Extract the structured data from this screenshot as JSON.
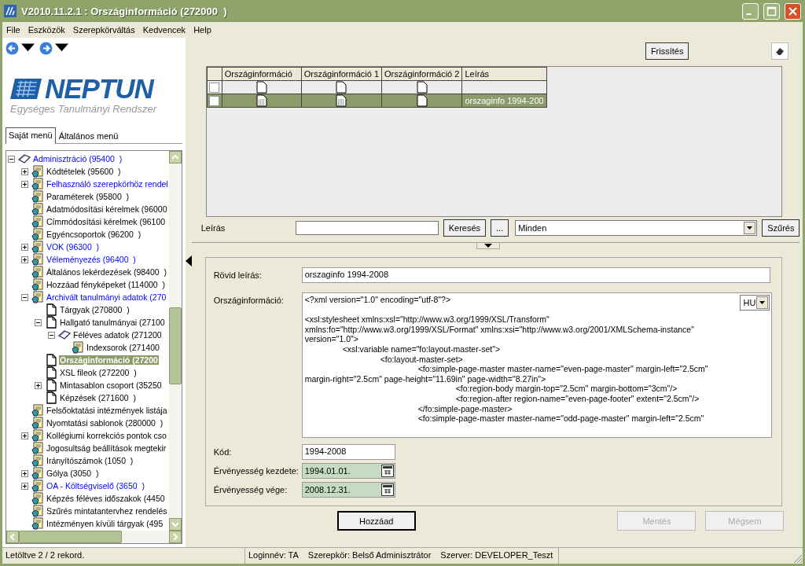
{
  "window": {
    "title": "V2010.11.2.1 : Országinformáció (272000  )"
  },
  "menu": [
    "File",
    "Eszközök",
    "Szerepkörváltás",
    "Kedvencek",
    "Help"
  ],
  "logo": {
    "name": "NEPTUN",
    "tagline": "Egységes Tanulmányi Rendszer"
  },
  "menu_tabs": [
    {
      "label": "Saját menü",
      "selected": true
    },
    {
      "label": "Általános menü",
      "selected": false
    }
  ],
  "tree": [
    {
      "label": "Adminisztráció (95400  )",
      "kind": "book",
      "highlighted": true,
      "expanded": true,
      "selected": false,
      "children": [
        {
          "label": "Kódtételek (95600  )",
          "kind": "form",
          "highlighted": false,
          "expanded": false,
          "selected": false
        },
        {
          "label": "Felhasználó szerepkörhöz rendel",
          "kind": "form",
          "highlighted": true,
          "expanded": false,
          "selected": false
        },
        {
          "label": "Paraméterek (95800  )",
          "kind": "form",
          "highlighted": false,
          "selected": false
        },
        {
          "label": "Adatmódosítási kérelmek (96000",
          "kind": "form",
          "highlighted": false,
          "selected": false
        },
        {
          "label": "Címmódosítási kérelmek (96100",
          "kind": "form",
          "highlighted": false,
          "selected": false
        },
        {
          "label": "Egyéncsoportok (96200  )",
          "kind": "form",
          "highlighted": false,
          "selected": false
        },
        {
          "label": "VOK (96300  )",
          "kind": "form",
          "highlighted": true,
          "expanded": false,
          "selected": false
        },
        {
          "label": "Véleményezés (96400  )",
          "kind": "form",
          "highlighted": true,
          "expanded": false,
          "selected": false
        },
        {
          "label": "Általános lekérdezések (98400  )",
          "kind": "form",
          "highlighted": false,
          "selected": false
        },
        {
          "label": "Hozzáad fényképeket (114000  )",
          "kind": "form",
          "highlighted": false,
          "selected": false
        },
        {
          "label": "Archivált tanulmányi adatok (270",
          "kind": "form",
          "highlighted": true,
          "expanded": true,
          "selected": false,
          "children": [
            {
              "label": "Tárgyak (270800  )",
              "kind": "page",
              "highlighted": false,
              "selected": false
            },
            {
              "label": "Hallgató tanulmányai (27100",
              "kind": "page",
              "highlighted": false,
              "expanded": true,
              "selected": false,
              "children": [
                {
                  "label": "Féléves adatok (271200",
                  "kind": "book",
                  "highlighted": false,
                  "expanded": true,
                  "selected": false,
                  "children": [
                    {
                      "label": "Indexsorok (271400",
                      "kind": "form",
                      "highlighted": false,
                      "selected": false
                    }
                  ]
                }
              ]
            },
            {
              "label": "Országinformáció (27200",
              "kind": "page",
              "selected": true
            },
            {
              "label": "XSL fileok (272200  )",
              "kind": "page",
              "highlighted": false,
              "selected": false
            },
            {
              "label": "Mintasablon csoport (35250",
              "kind": "page",
              "highlighted": false,
              "expanded": false,
              "selected": false
            },
            {
              "label": "Képzések (271600  )",
              "kind": "page",
              "highlighted": false,
              "selected": false
            }
          ]
        },
        {
          "label": "Felsőoktatási intézmények listája",
          "kind": "form",
          "highlighted": false,
          "selected": false
        },
        {
          "label": "Nyomtatási sablonok (280000  )",
          "kind": "form",
          "highlighted": false,
          "selected": false
        },
        {
          "label": "Kollégiumi korrekciós pontok cso",
          "kind": "form",
          "highlighted": false,
          "expanded": false,
          "selected": false
        },
        {
          "label": "Jogosultság beállítások megtekir",
          "kind": "form",
          "highlighted": false,
          "selected": false
        },
        {
          "label": "Irányítószámok (1050  )",
          "kind": "form",
          "highlighted": false,
          "selected": false
        },
        {
          "label": "Gólya (3050  )",
          "kind": "form",
          "highlighted": false,
          "expanded": false,
          "selected": false
        },
        {
          "label": "OA - Költségviselő (3650  )",
          "kind": "form",
          "highlighted": true,
          "expanded": false,
          "selected": false
        },
        {
          "label": "Képzés féléves időszakok (4450",
          "kind": "form",
          "highlighted": false,
          "selected": false
        },
        {
          "label": "Szűrés mintatantervhez rendelés",
          "kind": "form",
          "highlighted": false,
          "selected": false
        },
        {
          "label": "Intézményen kívüli tárgyak (495",
          "kind": "form",
          "highlighted": false,
          "selected": false
        }
      ]
    }
  ],
  "toolbar": {
    "refresh": "Frissítés"
  },
  "grid": {
    "columns": [
      "Országinformáció",
      "Országinformáció 1",
      "Országinformáció 2",
      "Leírás"
    ],
    "rows": [
      {
        "checked": false,
        "selected": false,
        "files": [
          {
            "kind": "blank"
          },
          {
            "kind": "blank"
          },
          {
            "kind": "blank"
          }
        ]
      },
      {
        "checked": false,
        "selected": true,
        "files": [
          {
            "kind": "filled"
          },
          {
            "kind": "filled"
          },
          {
            "kind": "blank"
          }
        ],
        "description": "orszaginfo 1994-200"
      }
    ]
  },
  "filter": {
    "label": "Leírás",
    "search": "Keresés",
    "more": "...",
    "scope": "Minden",
    "apply": "Szűrés"
  },
  "detail": {
    "fields": [
      {
        "label": "Rövid leírás:",
        "kind": "text",
        "value": "orszaginfo 1994-2008",
        "required": false
      },
      {
        "label": "Országinformáció:",
        "kind": "xml",
        "language": "HU",
        "value": "<?xml version=\"1.0\" encoding=\"utf-8\"?>\n\n<xsl:stylesheet xmlns:xsl=\"http://www.w3.org/1999/XSL/Transform\"\nxmlns:fo=\"http://www.w3.org/1999/XSL/Format\" xmlns:xsi=\"http://www.w3.org/2001/XMLSchema-instance\"\nversion=\"1.0\">\n\t<xsl:variable name=\"fo:layout-master-set\">\n\t\t<fo:layout-master-set>\n\t\t\t<fo:simple-page-master master-name=\"even-page-master\" margin-left=\"2.5cm\"\nmargin-right=\"2.5cm\" page-height=\"11.69in\" page-width=\"8.27in\">\n\t\t\t\t<fo:region-body margin-top=\"2.5cm\" margin-bottom=\"3cm\"/>\n\t\t\t\t<fo:region-after region-name=\"even-page-footer\" extent=\"2.5cm\"/>\n\t\t\t</fo:simple-page-master>\n\t\t\t<fo:simple-page-master master-name=\"odd-page-master\" margin-left=\"2.5cm\""
      },
      {
        "label": "Kód:",
        "kind": "text",
        "value": "1994-2008",
        "required": false
      },
      {
        "label": "Érvényesség kezdete:",
        "kind": "date",
        "value": "1994.01.01.",
        "required": true
      },
      {
        "label": "Érvényesség vége:",
        "kind": "date",
        "value": "2008.12.31.",
        "required": true
      }
    ]
  },
  "buttons": [
    {
      "label": "Hozzáad",
      "disabled": false
    },
    {
      "label": "Mentés",
      "disabled": true
    },
    {
      "label": "Mégsem",
      "disabled": true
    }
  ],
  "status_bar": {
    "records": "Letöltve 2 / 2 rekord.",
    "items": [
      "Loginnév: TA",
      "Szerepkör: Belső Adminisztrátor",
      "Szerver: DEVELOPER_Teszt"
    ]
  }
}
